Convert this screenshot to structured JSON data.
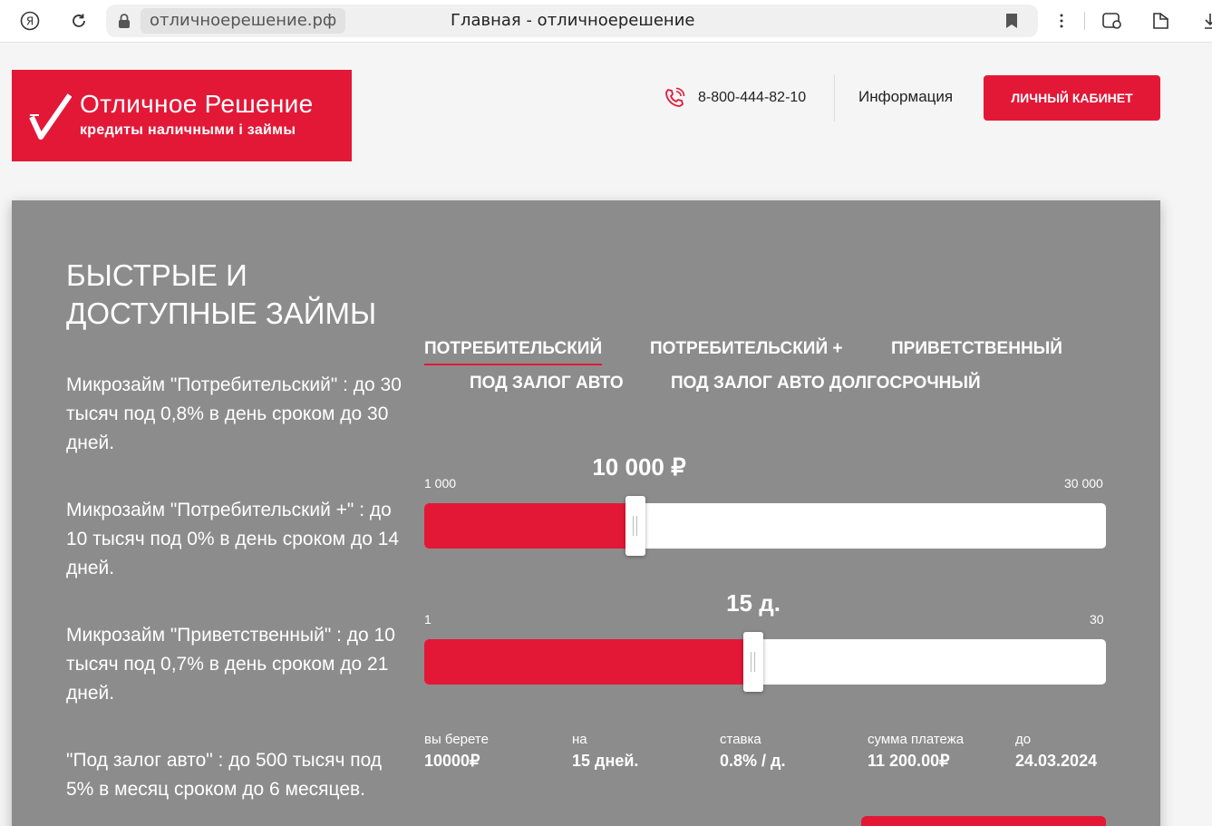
{
  "browser": {
    "url": "отличноерешение.рф",
    "title": "Главная - отличноерешение"
  },
  "header": {
    "logo_title": "Отличное Решение",
    "logo_subtitle": "кредиты наличными і займы",
    "phone": "8-800-444-82-10",
    "info_link": "Информация",
    "cabinet_button": "ЛИЧНЫЙ КАБИНЕТ"
  },
  "main": {
    "headline": "БЫСТРЫЕ И ДОСТУПНЫЕ ЗАЙМЫ",
    "descriptions": [
      "Микрозайм \"Потребительский\" : до 30 тысяч под 0,8% в день сроком до 30 дней.",
      "Микрозайм \"Потребительский +\" : до 10 тысяч под 0% в день сроком до 14 дней.",
      "Микрозайм \"Приветственный\" : до 10 тысяч под 0,7% в день сроком до 21 дней.",
      "\"Под залог авто\" : до 500 тысяч под 5% в месяц сроком до 6 месяцев."
    ],
    "tabs": [
      {
        "label": "ПОТРЕБИТЕЛЬСКИЙ",
        "active": true
      },
      {
        "label": "ПОТРЕБИТЕЛЬСКИЙ +",
        "active": false
      },
      {
        "label": "ПРИВЕТСТВЕННЫЙ",
        "active": false
      },
      {
        "label": "ПОД ЗАЛОГ АВТО",
        "active": false
      },
      {
        "label": "ПОД ЗАЛОГ АВТО ДОЛГОСРОЧНЫЙ",
        "active": false
      }
    ]
  },
  "calculator": {
    "amount": {
      "display": "10 000 ₽",
      "min_label": "1 000",
      "max_label": "30 000",
      "min": 1000,
      "max": 30000,
      "value": 10000
    },
    "term": {
      "display": "15 д.",
      "min_label": "1",
      "max_label": "30",
      "min": 1,
      "max": 30,
      "value": 15
    },
    "summary": [
      {
        "label": "вы берете",
        "value": "10000₽"
      },
      {
        "label": "на",
        "value": "15 дней."
      },
      {
        "label": "ставка",
        "value": "0.8% / д."
      },
      {
        "label": "сумма платежа",
        "value": "11 200.00₽"
      },
      {
        "label": "до",
        "value": "24.03.2024"
      }
    ]
  },
  "colors": {
    "accent": "#e31837",
    "card": "#8c8c8c",
    "page": "#f5f5f5"
  }
}
